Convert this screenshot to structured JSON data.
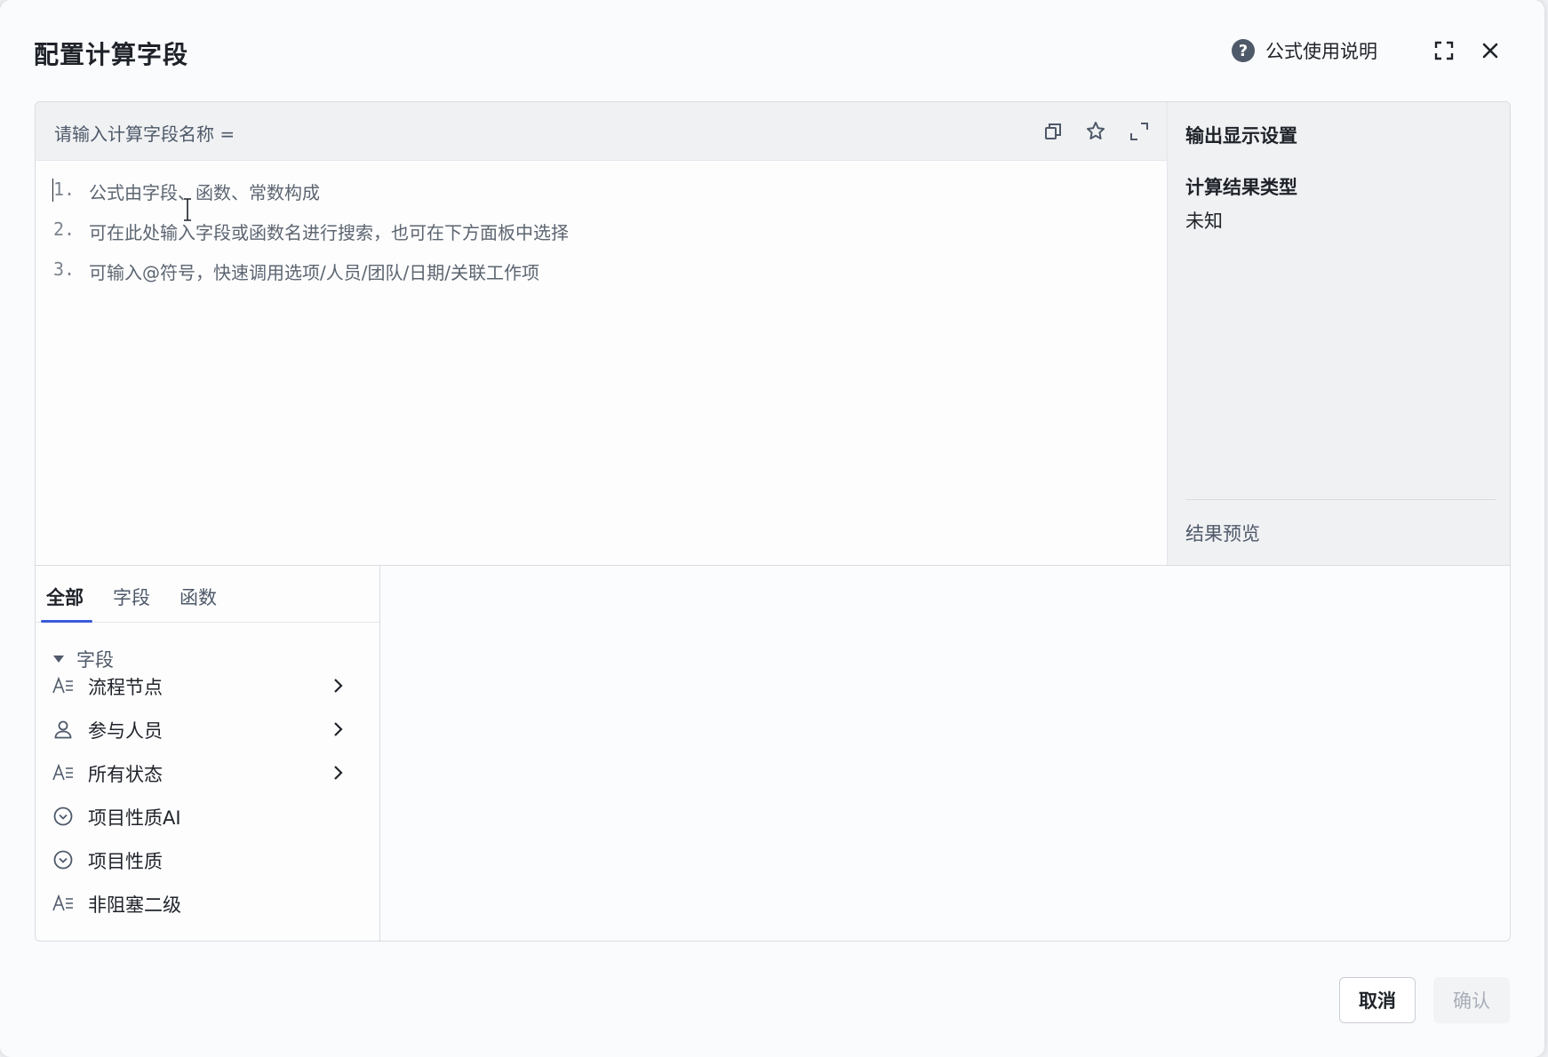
{
  "dialog": {
    "title": "配置计算字段",
    "help_label": "公式使用说明"
  },
  "editor": {
    "name_placeholder": "请输入计算字段名称 =",
    "lines": [
      {
        "num": "1.",
        "text": "公式由字段、函数、常数构成"
      },
      {
        "num": "2.",
        "text": "可在此处输入字段或函数名进行搜索，也可在下方面板中选择"
      },
      {
        "num": "3.",
        "text": "可输入@符号，快速调用选项/人员/团队/日期/关联工作项"
      }
    ]
  },
  "settings": {
    "title": "输出显示设置",
    "result_type_label": "计算结果类型",
    "result_type_value": "未知",
    "preview_label": "结果预览"
  },
  "picker": {
    "tabs": [
      "全部",
      "字段",
      "函数"
    ],
    "active_tab": "全部",
    "group_label": "字段",
    "items": [
      {
        "label": "流程节点",
        "icon": "text-field-icon",
        "has_children": true
      },
      {
        "label": "参与人员",
        "icon": "person-icon",
        "has_children": true
      },
      {
        "label": "所有状态",
        "icon": "text-field-icon",
        "has_children": true
      },
      {
        "label": "项目性质AI",
        "icon": "select-circle-icon",
        "has_children": false
      },
      {
        "label": "项目性质",
        "icon": "select-circle-icon",
        "has_children": false
      },
      {
        "label": "非阻塞二级",
        "icon": "text-field-icon",
        "has_children": false
      }
    ]
  },
  "footer": {
    "cancel_label": "取消",
    "confirm_label": "确认"
  },
  "colors": {
    "accent": "#3a5bd9",
    "confirm_disabled_bg": "#f2f3f5",
    "confirm_disabled_text": "#a9aeb8"
  }
}
